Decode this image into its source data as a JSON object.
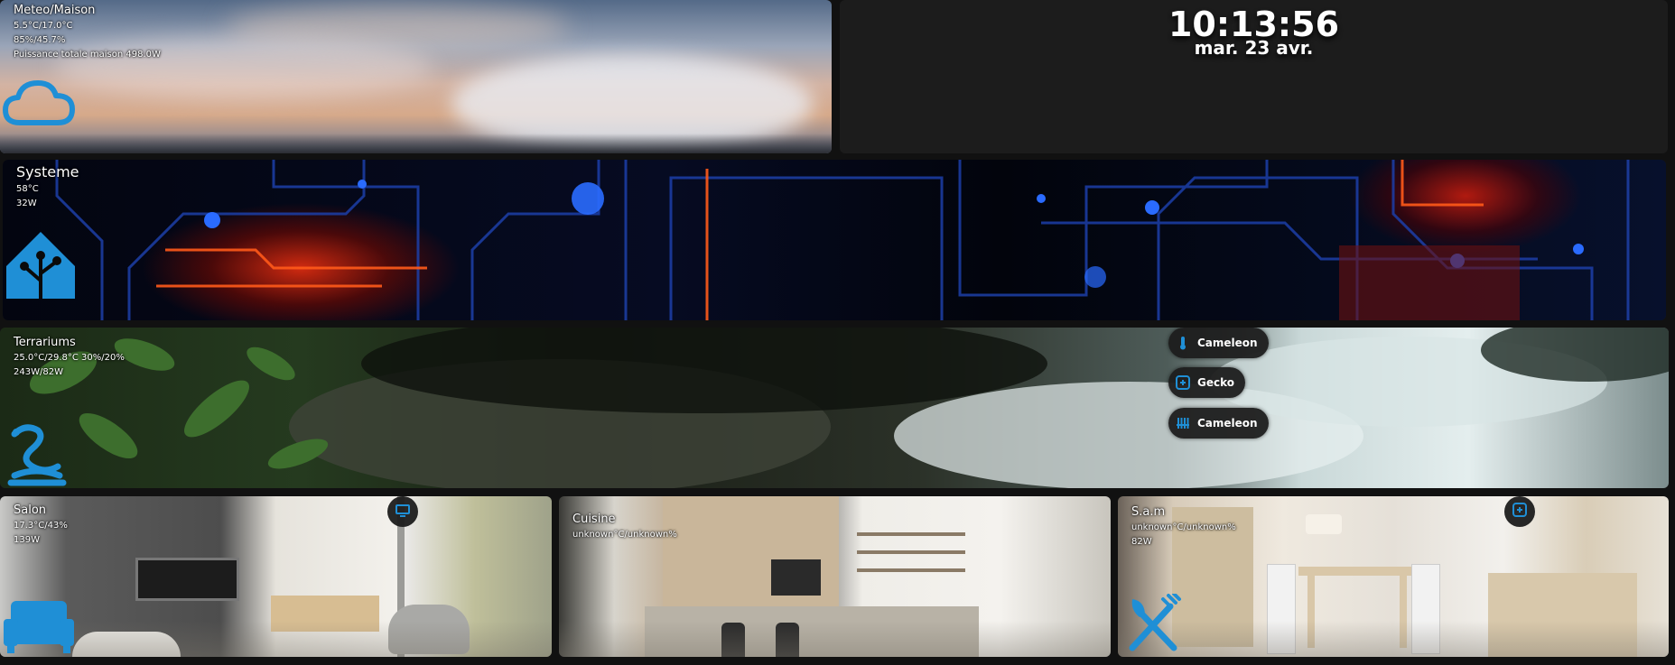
{
  "colors": {
    "accent": "#1f8fd6",
    "card_bg": "#1c1c1c",
    "page_bg": "#111111"
  },
  "meteo": {
    "title": "Meteo/Maison",
    "line1": "5.5°C/17.0°C",
    "line2": "85%/45.7%",
    "line3": "Puissance totale maison 498.0W",
    "icon": "cloud-icon"
  },
  "clock": {
    "time": "10:13:56",
    "date": "mar. 23 avr."
  },
  "systeme": {
    "title": "Systeme",
    "line1": "58°C",
    "line2": "32W",
    "icon": "home-assistant-icon"
  },
  "terrariums": {
    "title": "Terrariums",
    "line1": "25.0°C/29.8°C 30%/20%",
    "line2": "243W/82W",
    "icon": "snake-icon",
    "buttons": [
      {
        "label": "Cameleon",
        "icon": "thermometer-icon"
      },
      {
        "label": "Gecko",
        "icon": "gecko-icon"
      },
      {
        "label": "Cameleon",
        "icon": "heater-icon"
      }
    ]
  },
  "salon": {
    "title": "Salon",
    "line1": "17.3°C/43%",
    "line2": "139W",
    "icon": "sofa-icon",
    "badge_icon": "television-icon"
  },
  "cuisine": {
    "title": "Cuisine",
    "line1": "unknown°C/unknown%"
  },
  "sam": {
    "title": "S.a.m",
    "line1": "unknown°C/unknown%",
    "line2": "82W",
    "icon": "silverware-icon",
    "badge_icon": "gecko-icon"
  }
}
